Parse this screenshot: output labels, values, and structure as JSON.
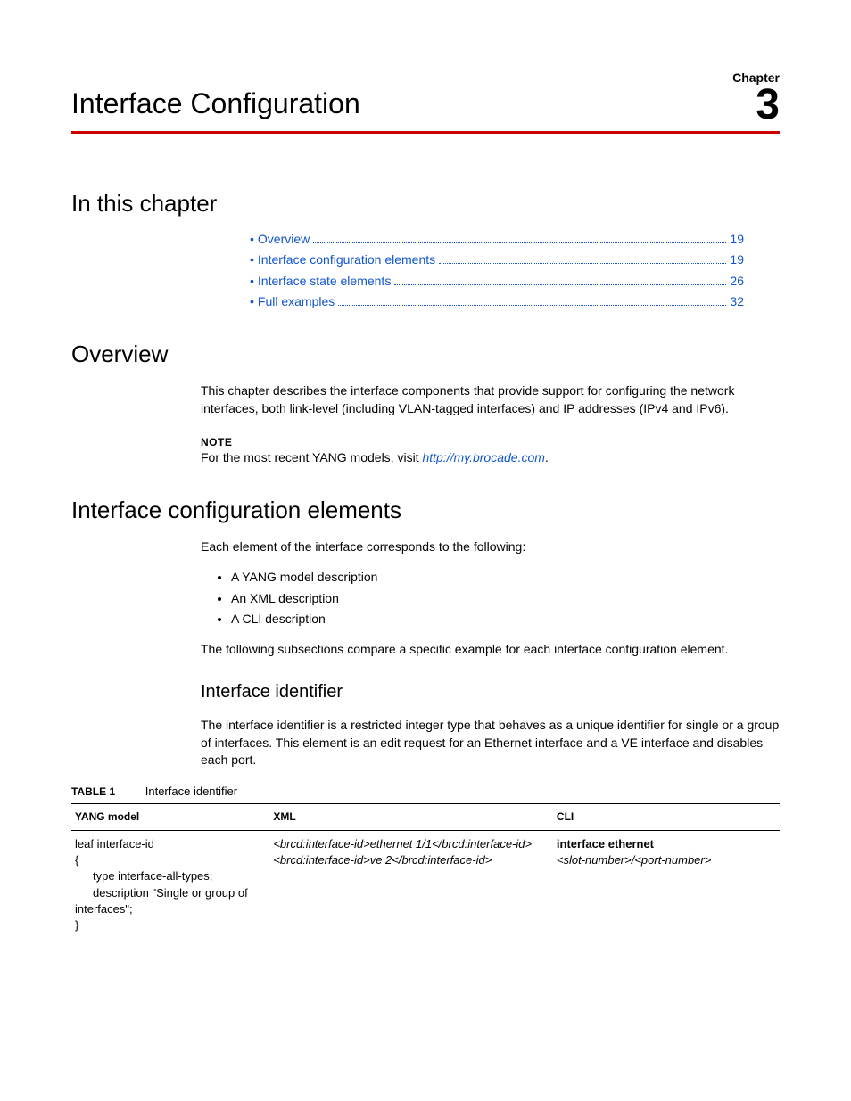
{
  "chapter": {
    "label": "Chapter",
    "number": "3",
    "title": "Interface Configuration"
  },
  "sections": {
    "toc_heading": "In this chapter",
    "overview_heading": "Overview",
    "ice_heading": "Interface configuration elements",
    "iid_heading": "Interface identifier"
  },
  "toc": [
    {
      "label": "Overview",
      "page": "19"
    },
    {
      "label": "Interface configuration elements",
      "page": "19"
    },
    {
      "label": "Interface state elements",
      "page": "26"
    },
    {
      "label": "Full examples",
      "page": "32"
    }
  ],
  "overview": {
    "para": "This chapter describes the interface components that provide support for configuring the network interfaces, both link-level (including VLAN-tagged interfaces) and IP addresses (IPv4 and IPv6).",
    "note_label": "NOTE",
    "note_pre": "For the most recent YANG models, visit ",
    "note_link": "http://my.brocade.com",
    "note_post": "."
  },
  "ice": {
    "intro": "Each element of the interface corresponds to the following:",
    "bullets": [
      "A YANG model description",
      "An XML description",
      "A CLI description"
    ],
    "outro": "The following subsections compare a specific example for each interface configuration element."
  },
  "iid": {
    "para": "The interface identifier is a restricted integer type that behaves as a unique identifier for single or a group of interfaces. This element is an edit request for an Ethernet interface and a VE interface and disables each port."
  },
  "table1": {
    "caption_label": "TABLE 1",
    "caption_text": "Interface identifier",
    "headers": {
      "yang": "YANG model",
      "xml": "XML",
      "cli": "CLI"
    },
    "yang": {
      "l1": "leaf interface-id",
      "l2": "{",
      "l3": "type interface-all-types;",
      "l4": "description \"Single or group of",
      "l5": "interfaces\";",
      "l6": "}"
    },
    "xml": {
      "l1": "<brcd:interface-id>ethernet 1/1</brcd:interface-id>",
      "l2": "<brcd:interface-id>ve 2</brcd:interface-id>"
    },
    "cli": {
      "l1": "interface ethernet",
      "l2": "<slot-number>/<port-number>"
    }
  }
}
